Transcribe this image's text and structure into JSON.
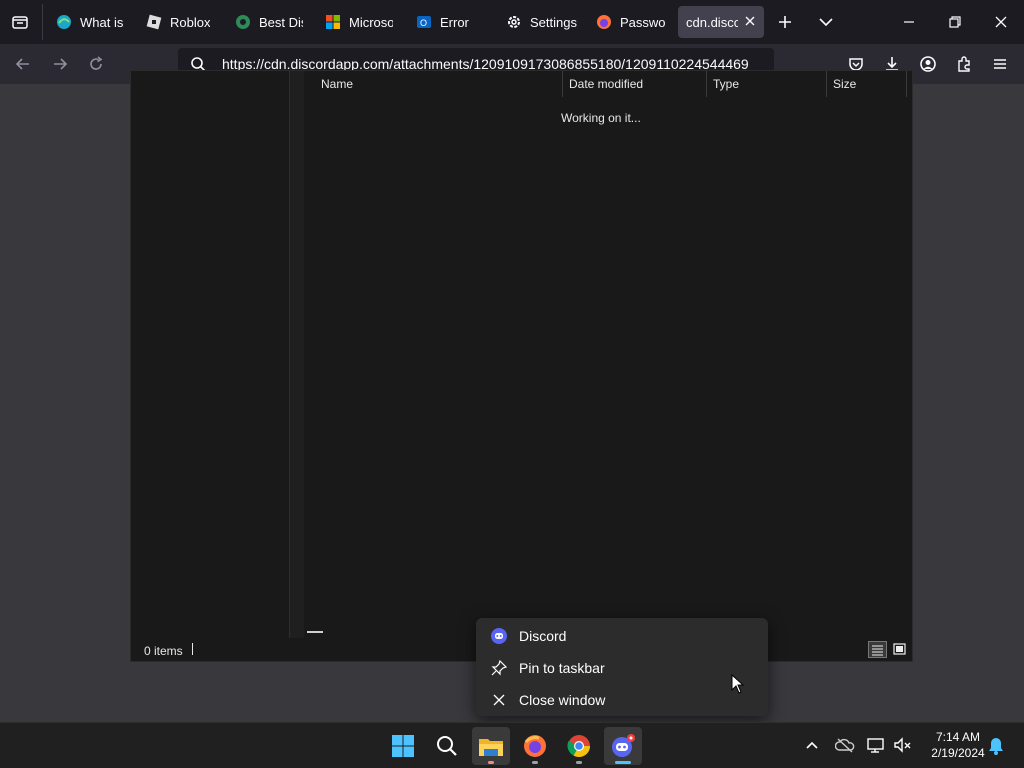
{
  "browser": {
    "tabs": [
      {
        "label": "What is |",
        "icon": "edge-globe-icon"
      },
      {
        "label": "Roblox",
        "icon": "roblox-icon"
      },
      {
        "label": "Best Disp",
        "icon": "site-icon"
      },
      {
        "label": "Microsof",
        "icon": "microsoft-icon"
      },
      {
        "label": "Error",
        "icon": "outlook-icon"
      },
      {
        "label": "Settings",
        "icon": "gear-icon"
      },
      {
        "label": "Passwor",
        "icon": "firefox-icon"
      },
      {
        "label": "cdn.disco",
        "icon": "none",
        "active": true
      }
    ],
    "url": "https://cdn.discordapp.com/attachments/1209109173086855180/1209110224544469"
  },
  "dialog": {
    "columns": [
      "Name",
      "Date modified",
      "Type",
      "Size"
    ],
    "status_message": "Working on it...",
    "item_count": "0 items"
  },
  "context_menu": {
    "items": [
      {
        "label": "Discord",
        "icon": "discord-icon"
      },
      {
        "label": "Pin to taskbar",
        "icon": "pin-icon"
      },
      {
        "label": "Close window",
        "icon": "close-icon"
      }
    ]
  },
  "taskbar": {
    "apps": [
      "start-icon",
      "search-icon",
      "file-explorer-icon",
      "firefox-icon",
      "chrome-icon",
      "discord-icon"
    ],
    "clock": {
      "time": "7:14 AM",
      "date": "2/19/2024"
    }
  },
  "colors": {
    "accent": "#5865f2",
    "chrome_bg": "#1c1b22",
    "active_tab": "#42414d"
  }
}
